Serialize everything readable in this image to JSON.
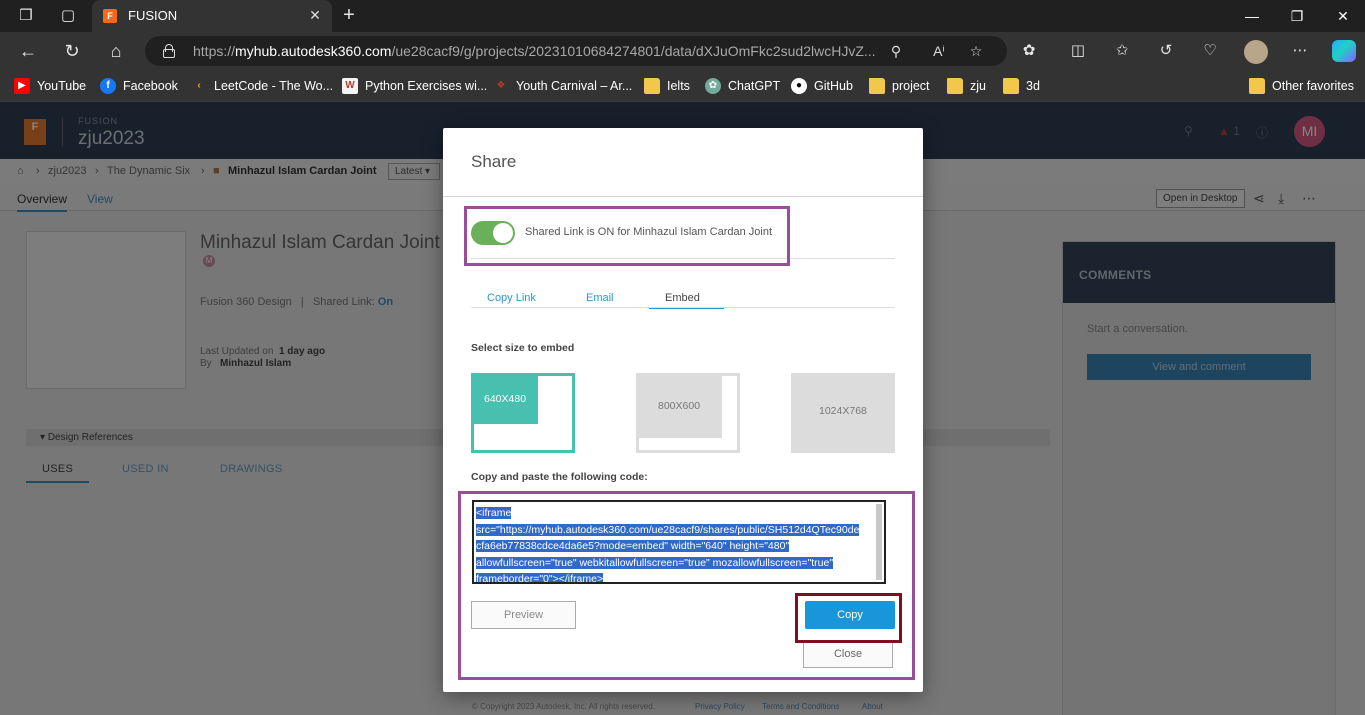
{
  "browser": {
    "tab_title": "FUSION",
    "tab_favicon": "F",
    "url_prefix": "https://",
    "url_host": "myhub.autodesk360.com",
    "url_path": "/ue28cacf9/g/projects/20231010684274801/data/dXJuOmFkc2sud2lwcHJvZ...",
    "window_controls": [
      "minimize-icon",
      "restore-icon",
      "close-icon"
    ]
  },
  "bookmarks": [
    {
      "label": "YouTube",
      "icon": "youtube-icon",
      "color": "#ff0000"
    },
    {
      "label": "Facebook",
      "icon": "facebook-icon",
      "color": "#1877f2"
    },
    {
      "label": "LeetCode - The Wo...",
      "icon": "leetcode-icon",
      "color": "#f89f1b"
    },
    {
      "label": "Python Exercises wi...",
      "icon": "w3resource-icon",
      "color": "#c0392b"
    },
    {
      "label": "Youth Carnival – Ar...",
      "icon": "carnival-icon",
      "color": "#b03a3a"
    },
    {
      "label": "Ielts",
      "icon": "folder-icon",
      "color": "#f1c84b"
    },
    {
      "label": "ChatGPT",
      "icon": "chatgpt-icon",
      "color": "#74aa9c"
    },
    {
      "label": "GitHub",
      "icon": "github-icon",
      "color": "#ffffff"
    },
    {
      "label": "project",
      "icon": "folder-icon",
      "color": "#f1c84b"
    },
    {
      "label": "zju",
      "icon": "folder-icon",
      "color": "#f1c84b"
    },
    {
      "label": "3d",
      "icon": "folder-icon",
      "color": "#f1c84b"
    },
    {
      "label": "Other favorites",
      "icon": "folder-icon",
      "color": "#f1c84b"
    }
  ],
  "app": {
    "product": "FUSION",
    "project": "zju2023",
    "notification_count": "1",
    "avatar_initials": "MI",
    "breadcrumbs": [
      "zju2023",
      "The Dynamic Six",
      "Minhazul Islam Cardan Joint"
    ],
    "version_select": "Latest",
    "subtabs": [
      "Overview",
      "View"
    ],
    "open_in_desktop": "Open in Desktop",
    "design_name": "Minhazul Islam Cardan Joint",
    "design_type": "Fusion 360 Design",
    "shared_link_label": "Shared Link:",
    "shared_link_value": "On",
    "last_updated_label": "Last Updated on",
    "last_updated_value": "1 day ago",
    "by_label": "By",
    "by_value": "Minhazul Islam",
    "design_references": "Design References",
    "lower_tabs": [
      "USES",
      "USED IN",
      "DRAWINGS"
    ],
    "comments_title": "COMMENTS",
    "comments_empty": "Start a conversation.",
    "comments_button": "View and comment",
    "footer": {
      "copyright": "© Copyright 2023 Autodesk, Inc. All rights reserved.",
      "links": [
        "Privacy Policy",
        "Terms and Conditions",
        "About"
      ]
    }
  },
  "modal": {
    "title": "Share",
    "toggle_label": "Shared Link is ON for Minhazul Islam Cardan Joint",
    "toggle_on": true,
    "tabs": [
      "Copy Link",
      "Email",
      "Embed"
    ],
    "active_tab": "Embed",
    "size_label": "Select size to embed",
    "sizes": [
      "640X480",
      "800X600",
      "1024X768"
    ],
    "selected_size": "640X480",
    "code_label": "Copy and paste the following code:",
    "code_lines": [
      "<iframe",
      "src=\"https://myhub.autodesk360.com/ue28cacf9/shares/public/SH512d4QTec90de",
      "cfa6eb77838cdce4da6e5?mode=embed\" width=\"640\" height=\"480\"",
      "allowfullscreen=\"true\" webkitallowfullscreen=\"true\" mozallowfullscreen=\"true\"",
      "frameborder=\"0\"></iframe>"
    ],
    "preview_button": "Preview",
    "copy_button": "Copy",
    "close_button": "Close"
  },
  "colors": {
    "accent": "#1996d9",
    "toggle_on": "#6aaf5a",
    "selection": "#3169c9",
    "size_selected": "#48c0b0",
    "annotation_purple": "#9a4d9a",
    "annotation_red": "#7a1020"
  }
}
